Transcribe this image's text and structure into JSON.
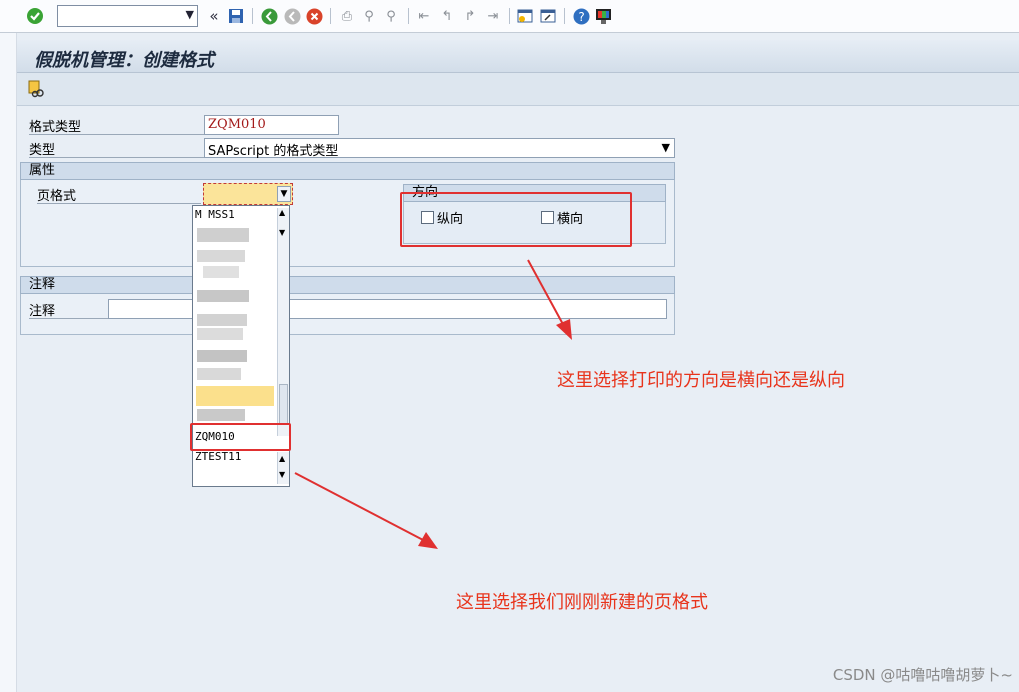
{
  "toolbar": {
    "command_value": "",
    "icons": [
      "ok-check-icon",
      "command-dropdown-icon",
      "collapse-icon",
      "save-icon",
      "back-icon",
      "exit-icon",
      "cancel-icon",
      "print-icon",
      "find-icon",
      "find-next-icon",
      "first-page-icon",
      "prev-page-icon",
      "next-page-icon",
      "last-page-icon",
      "new-session-icon",
      "shortcut-icon",
      "help-icon",
      "layout-icon"
    ]
  },
  "title": "假脱机管理：创建格式",
  "form": {
    "format_type_label": "格式类型",
    "format_type_value": "ZQM010",
    "type_label": "类型",
    "type_value": "SAPscript 的格式类型",
    "attributes_header": "属性",
    "page_format_label": "页格式",
    "page_format_value": "",
    "orientation_header": "方向",
    "portrait_label": "纵向",
    "landscape_label": "横向",
    "comment_header": "注释",
    "comment_label": "注释",
    "comment_value": ""
  },
  "dropdown": {
    "first_item": "M    MSS1",
    "selected_item": "ZQM010",
    "last_item": "ZTEST11"
  },
  "annotations": {
    "orientation_note": "这里选择打印的方向是横向还是纵向",
    "page_format_note": "这里选择我们刚刚新建的页格式"
  },
  "watermark": "CSDN @咕噜咕噜胡萝卜~",
  "colors": {
    "annotation_red": "#e03030",
    "sap_bg": "#e8eef5",
    "field_highlight": "#fbe49a"
  }
}
